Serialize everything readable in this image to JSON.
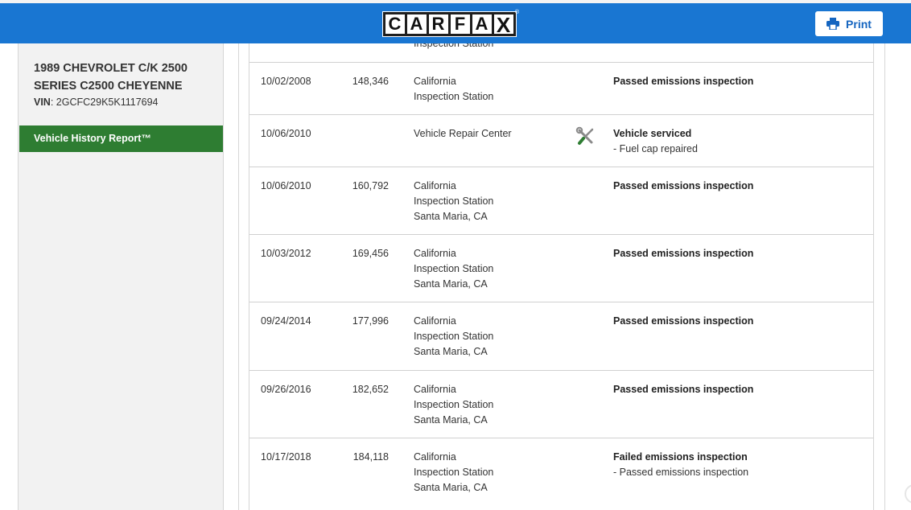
{
  "header": {
    "logo_letters": [
      "C",
      "A",
      "R",
      "F",
      "A",
      "X"
    ],
    "print_label": "Print",
    "brand_color": "#1976d2"
  },
  "sidebar": {
    "vehicle_title": "1989 CHEVROLET C/K 2500 SERIES C2500 CHEYENNE",
    "vin_label": "VIN",
    "vin_value": "2GCFC29K5K1117694",
    "nav_item": "Vehicle History Report™",
    "nav_color": "#2e7d32"
  },
  "records": {
    "partial_top_source": "Inspection Station",
    "rows": [
      {
        "date": "10/02/2008",
        "odometer": "148,346",
        "source": [
          "California",
          "Inspection Station"
        ],
        "icon": "",
        "title": "Passed emissions inspection",
        "details": []
      },
      {
        "date": "10/06/2010",
        "odometer": "",
        "source": [
          "Vehicle Repair Center"
        ],
        "icon": "wrench-screwdriver-icon",
        "title": "Vehicle serviced",
        "details": [
          "- Fuel cap repaired"
        ]
      },
      {
        "date": "10/06/2010",
        "odometer": "160,792",
        "source": [
          "California",
          "Inspection Station",
          "Santa Maria, CA"
        ],
        "icon": "",
        "title": "Passed emissions inspection",
        "details": []
      },
      {
        "date": "10/03/2012",
        "odometer": "169,456",
        "source": [
          "California",
          "Inspection Station",
          "Santa Maria, CA"
        ],
        "icon": "",
        "title": "Passed emissions inspection",
        "details": []
      },
      {
        "date": "09/24/2014",
        "odometer": "177,996",
        "source": [
          "California",
          "Inspection Station",
          "Santa Maria, CA"
        ],
        "icon": "",
        "title": "Passed emissions inspection",
        "details": []
      },
      {
        "date": "09/26/2016",
        "odometer": "182,652",
        "source": [
          "California",
          "Inspection Station",
          "Santa Maria, CA"
        ],
        "icon": "",
        "title": "Passed emissions inspection",
        "details": []
      },
      {
        "date": "10/17/2018",
        "odometer": "184,118",
        "source": [
          "California",
          "Inspection Station",
          "Santa Maria, CA"
        ],
        "icon": "",
        "title": "Failed emissions inspection",
        "details": [
          "- Passed emissions inspection"
        ]
      }
    ]
  }
}
